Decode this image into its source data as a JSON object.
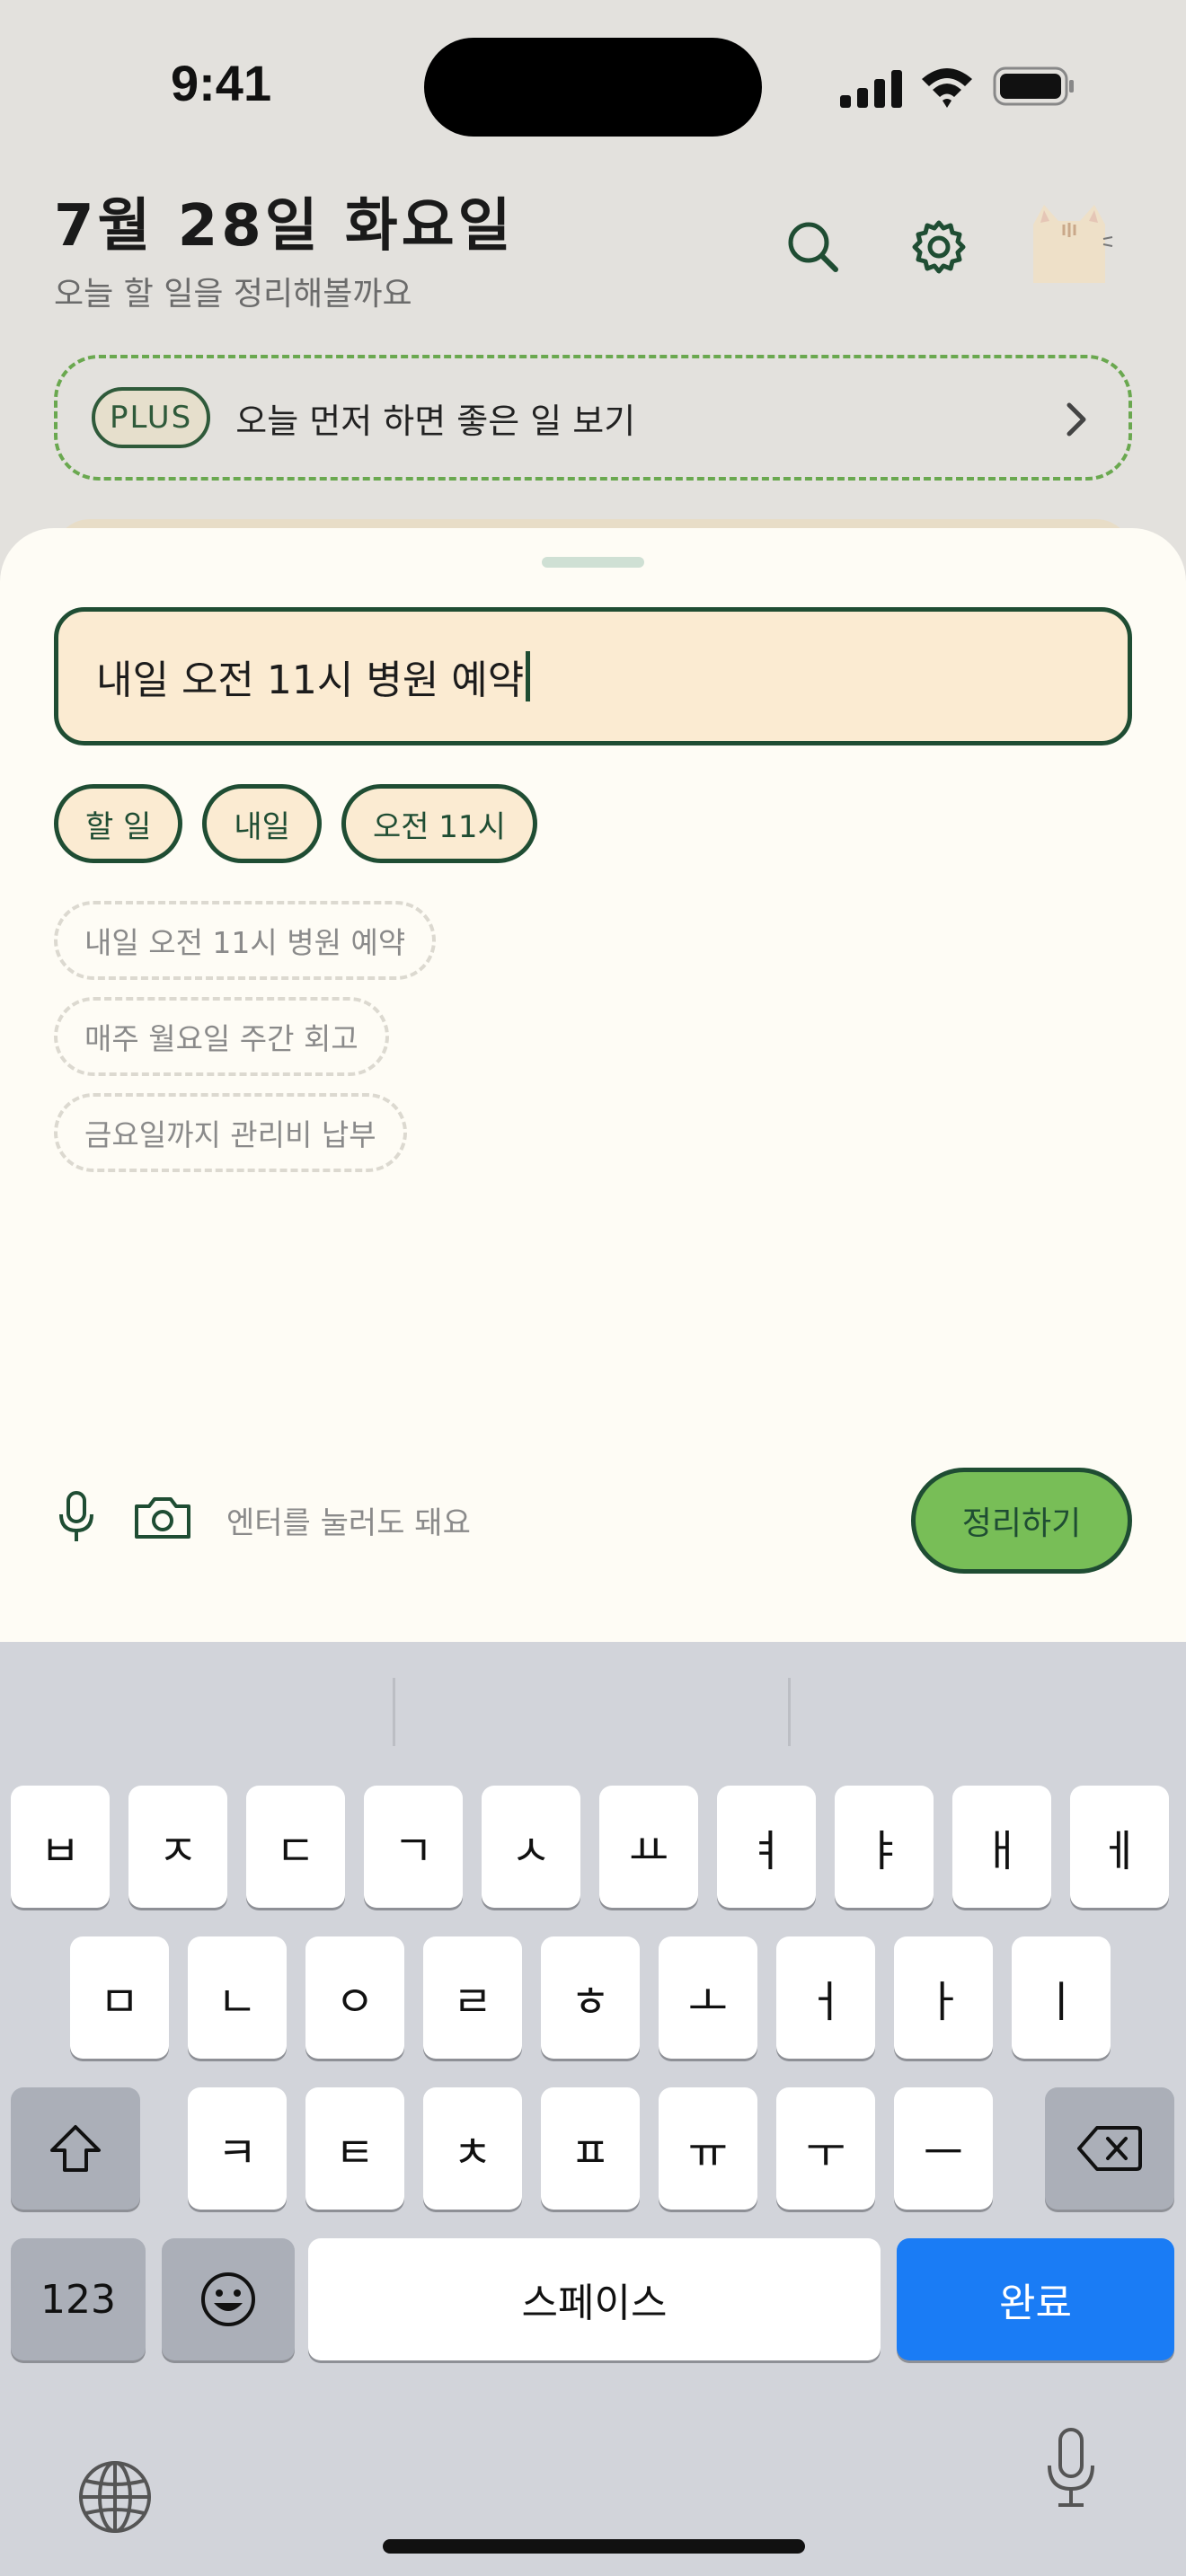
{
  "status_bar": {
    "time": "9:41"
  },
  "header": {
    "date_title": "7월 28일 화요일",
    "subtitle": "오늘 할 일을 정리해볼까요",
    "icons": [
      "search-icon",
      "gear-icon",
      "cat-avatar"
    ]
  },
  "plus_banner": {
    "badge": "PLUS",
    "text": "오늘 먼저 하면 좋은 일 보기",
    "icon": "chevron-right-icon"
  },
  "composer": {
    "input_value": "내일 오전 11시 병원 예약",
    "chips": [
      "할 일",
      "내일",
      "오전 11시"
    ],
    "suggestions": [
      "내일 오전 11시 병원 예약",
      "매주 월요일 주간 회고",
      "금요일까지 관리비 납부"
    ],
    "hint": "엔터를 눌러도 돼요",
    "submit_label": "정리하기"
  },
  "keyboard": {
    "row1": [
      "ㅂ",
      "ㅈ",
      "ㄷ",
      "ㄱ",
      "ㅅ",
      "ㅛ",
      "ㅕ",
      "ㅑ",
      "ㅐ",
      "ㅔ"
    ],
    "row2": [
      "ㅁ",
      "ㄴ",
      "ㅇ",
      "ㄹ",
      "ㅎ",
      "ㅗ",
      "ㅓ",
      "ㅏ",
      "ㅣ"
    ],
    "row3": [
      "ㅋ",
      "ㅌ",
      "ㅊ",
      "ㅍ",
      "ㅠ",
      "ㅜ",
      "ㅡ"
    ],
    "numbers_label": "123",
    "emoji_label": "😀",
    "space_label": "스페이스",
    "done_label": "완료"
  },
  "colors": {
    "accent_green": "#78be57",
    "dark_green": "#1f4d33",
    "input_bg": "#fbebd2",
    "keyboard_bg": "#d2d4da",
    "done_blue": "#1a7cf5"
  }
}
